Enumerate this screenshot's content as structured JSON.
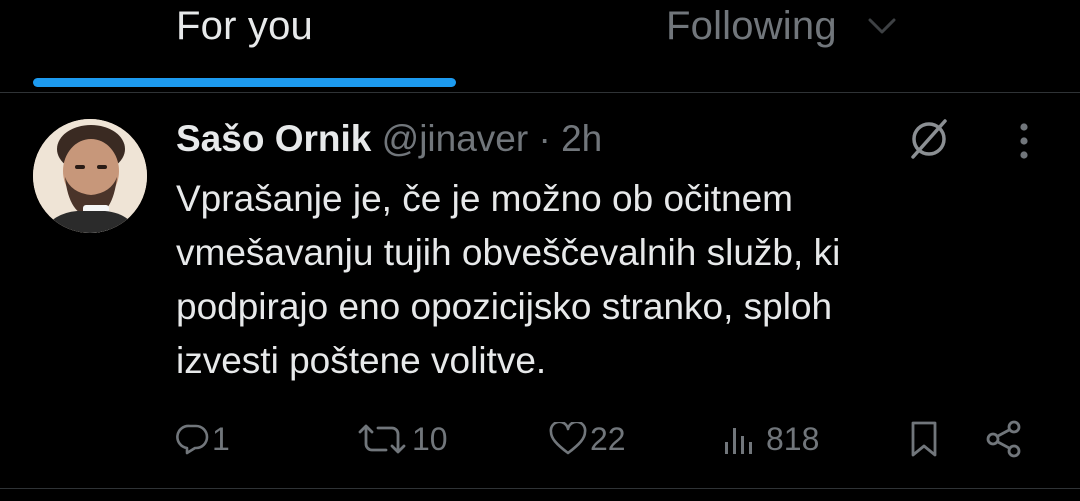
{
  "tabs": [
    {
      "label": "For you",
      "selected": true
    },
    {
      "label": "Following",
      "selected": false
    }
  ],
  "tweet": {
    "author_name": "Sašo Ornik",
    "handle": "@jinaver",
    "separator": "·",
    "time": "2h",
    "text_lines": [
      "Vprašanje je, če je možno ob očitnem",
      "vmešavanju tujih obveščevalnih služb, ki",
      "podpirajo eno opozicijsko stranko, sploh",
      "izvesti poštene volitve."
    ],
    "counts": {
      "replies": "1",
      "reposts": "10",
      "likes": "22",
      "views": "818"
    }
  },
  "colors": {
    "background": "#000000",
    "text_primary": "#e7e9ea",
    "text_secondary": "#71767b",
    "accent": "#1d9bf0",
    "divider": "#2f3336"
  },
  "icons": [
    "chevron-down-icon",
    "grok-icon",
    "more-icon",
    "reply-icon",
    "repost-icon",
    "like-icon",
    "views-icon",
    "bookmark-icon",
    "share-icon"
  ]
}
